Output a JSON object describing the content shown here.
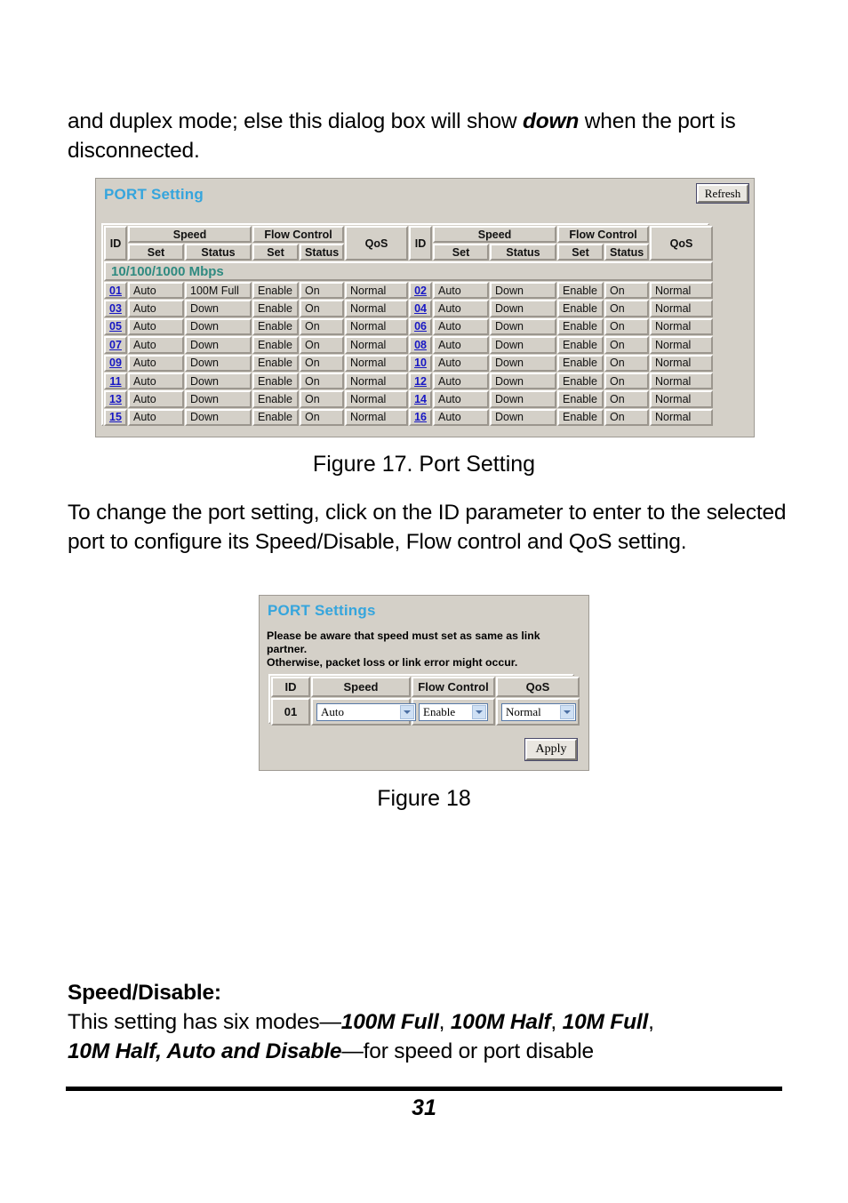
{
  "document": {
    "page_number": "31",
    "paragraph_top": {
      "before": "and duplex mode; else this dialog box will show ",
      "emphasis": "down",
      "after": " when the port is disconnected."
    },
    "figure17_caption": "Figure 17. Port Setting",
    "paragraph_middle": "To change the port setting, click on the ID parameter to enter to the selected port to configure its Speed/Disable, Flow control and QoS setting.",
    "figure18_caption": "Figure 18",
    "speed_disable": {
      "heading": "Speed/Disable:",
      "line1_lead": "This setting has six modes—",
      "modes_line1": "100M Full",
      "modes_sep1": ", ",
      "modes_line1b": "100M Half",
      "modes_sep2": ", ",
      "modes_line1c": "10M Full",
      "modes_sep3": ",",
      "modes_line2": "10M Half, Auto and Disable",
      "line2_tail": "—for speed or port disable"
    }
  },
  "colors": {
    "panel_title": "#35a5dd",
    "section_band": "#2f8a80",
    "link": "#1717c4",
    "panel_bg": "#d4d0c8"
  },
  "port_setting": {
    "title": "PORT Setting",
    "refresh_label": "Refresh",
    "headers": {
      "id": "ID",
      "speed": "Speed",
      "flow_control": "Flow Control",
      "qos": "QoS",
      "set": "Set",
      "status": "Status"
    },
    "section_band": "10/100/1000 Mbps",
    "rows": [
      {
        "left": {
          "id": "01",
          "speed_set": "Auto",
          "speed_status": "100M Full",
          "fc_set": "Enable",
          "fc_status": "On",
          "qos": "Normal"
        },
        "right": {
          "id": "02",
          "speed_set": "Auto",
          "speed_status": "Down",
          "fc_set": "Enable",
          "fc_status": "On",
          "qos": "Normal"
        }
      },
      {
        "left": {
          "id": "03",
          "speed_set": "Auto",
          "speed_status": "Down",
          "fc_set": "Enable",
          "fc_status": "On",
          "qos": "Normal"
        },
        "right": {
          "id": "04",
          "speed_set": "Auto",
          "speed_status": "Down",
          "fc_set": "Enable",
          "fc_status": "On",
          "qos": "Normal"
        }
      },
      {
        "left": {
          "id": "05",
          "speed_set": "Auto",
          "speed_status": "Down",
          "fc_set": "Enable",
          "fc_status": "On",
          "qos": "Normal"
        },
        "right": {
          "id": "06",
          "speed_set": "Auto",
          "speed_status": "Down",
          "fc_set": "Enable",
          "fc_status": "On",
          "qos": "Normal"
        }
      },
      {
        "left": {
          "id": "07",
          "speed_set": "Auto",
          "speed_status": "Down",
          "fc_set": "Enable",
          "fc_status": "On",
          "qos": "Normal"
        },
        "right": {
          "id": "08",
          "speed_set": "Auto",
          "speed_status": "Down",
          "fc_set": "Enable",
          "fc_status": "On",
          "qos": "Normal"
        }
      },
      {
        "left": {
          "id": "09",
          "speed_set": "Auto",
          "speed_status": "Down",
          "fc_set": "Enable",
          "fc_status": "On",
          "qos": "Normal"
        },
        "right": {
          "id": "10",
          "speed_set": "Auto",
          "speed_status": "Down",
          "fc_set": "Enable",
          "fc_status": "On",
          "qos": "Normal"
        }
      },
      {
        "left": {
          "id": "11",
          "speed_set": "Auto",
          "speed_status": "Down",
          "fc_set": "Enable",
          "fc_status": "On",
          "qos": "Normal"
        },
        "right": {
          "id": "12",
          "speed_set": "Auto",
          "speed_status": "Down",
          "fc_set": "Enable",
          "fc_status": "On",
          "qos": "Normal"
        }
      },
      {
        "left": {
          "id": "13",
          "speed_set": "Auto",
          "speed_status": "Down",
          "fc_set": "Enable",
          "fc_status": "On",
          "qos": "Normal"
        },
        "right": {
          "id": "14",
          "speed_set": "Auto",
          "speed_status": "Down",
          "fc_set": "Enable",
          "fc_status": "On",
          "qos": "Normal"
        }
      },
      {
        "left": {
          "id": "15",
          "speed_set": "Auto",
          "speed_status": "Down",
          "fc_set": "Enable",
          "fc_status": "On",
          "qos": "Normal"
        },
        "right": {
          "id": "16",
          "speed_set": "Auto",
          "speed_status": "Down",
          "fc_set": "Enable",
          "fc_status": "On",
          "qos": "Normal"
        }
      }
    ]
  },
  "port_settings_dialog": {
    "title": "PORT Settings",
    "note_line1": "Please be aware that speed must set as same as link partner.",
    "note_line2": "Otherwise, packet loss or link error might occur.",
    "headers": {
      "id": "ID",
      "speed": "Speed",
      "flow_control": "Flow Control",
      "qos": "QoS"
    },
    "row": {
      "id": "01",
      "speed_value": "Auto",
      "flow_control_value": "Enable",
      "qos_value": "Normal"
    },
    "apply_label": "Apply"
  }
}
